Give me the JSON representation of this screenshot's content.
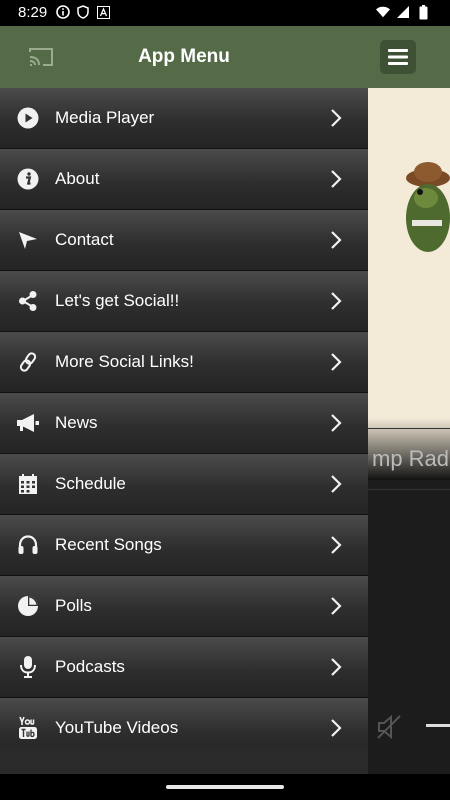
{
  "status_bar": {
    "time": "8:29",
    "icons_left": [
      "info-icon",
      "shield-icon",
      "a-badge-icon"
    ],
    "icons_right": [
      "wifi-icon",
      "signal-icon",
      "battery-icon"
    ]
  },
  "drawer": {
    "title": "App Menu",
    "header_color": "#556b47",
    "items": [
      {
        "label": "Media Player",
        "icon": "play-icon"
      },
      {
        "label": "About",
        "icon": "info-icon"
      },
      {
        "label": "Contact",
        "icon": "send-icon"
      },
      {
        "label": "Let's get Social!!",
        "icon": "share-icon"
      },
      {
        "label": "More Social Links!",
        "icon": "link-icon"
      },
      {
        "label": "News",
        "icon": "megaphone-icon"
      },
      {
        "label": "Schedule",
        "icon": "calendar-icon"
      },
      {
        "label": "Recent Songs",
        "icon": "headphones-icon"
      },
      {
        "label": "Polls",
        "icon": "pie-chart-icon"
      },
      {
        "label": "Podcasts",
        "icon": "microphone-icon"
      },
      {
        "label": "YouTube Videos",
        "icon": "youtube-icon"
      }
    ]
  },
  "background_app": {
    "station_text": "mp Radi",
    "top_bar_color": "#556b47"
  }
}
